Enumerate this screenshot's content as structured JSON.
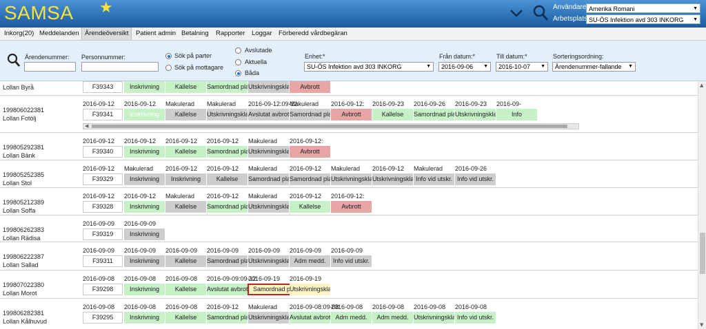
{
  "header": {
    "app_title": "SAMSA",
    "user_label": "Användare:",
    "user_value": "Amerika Romani",
    "workplace_label": "Arbetsplats:",
    "workplace_value": "SU-ÖS Infektion avd 303 INKORG"
  },
  "menu": [
    {
      "label": "Inkorg(20)",
      "active": false
    },
    {
      "label": "Meddelanden",
      "active": false
    },
    {
      "label": "Ärendeöversikt",
      "active": true
    },
    {
      "label": "Patient admin",
      "active": false
    },
    {
      "label": "Betalning",
      "active": false
    },
    {
      "label": "Rapporter",
      "active": false
    },
    {
      "label": "Loggar",
      "active": false
    },
    {
      "label": "Förberedd vårdbegäran",
      "active": false
    }
  ],
  "filters": {
    "case_number_label": "Ärendenummer:",
    "personal_number_label": "Personnummer:",
    "search_parties_label": "Sök på parter",
    "search_receiver_label": "Sök på mottagare",
    "status_completed_label": "Avslutade",
    "status_current_label": "Aktuella",
    "status_both_label": "Båda",
    "unit_label": "Enhet:*",
    "unit_value": "SU-ÖS Infektion avd 303 INKORG",
    "from_date_label": "Från datum:*",
    "from_date_value": "2016-09-06",
    "to_date_label": "Till datum:*",
    "to_date_value": "2016-10-07",
    "sort_label": "Sorteringsordning:",
    "sort_value": "Ärendenummer-fallande"
  },
  "rows": [
    {
      "pnr": "",
      "name": "Lollan Byrå",
      "case": "F39343",
      "steps": [
        {
          "label": "Inskrivning",
          "status": "green",
          "date": ""
        },
        {
          "label": "Kallelse",
          "status": "green",
          "date": ""
        },
        {
          "label": "Samordnad plan",
          "status": "green",
          "date": ""
        },
        {
          "label": "Utskrivningsklar",
          "status": "grey",
          "date": ""
        },
        {
          "label": "Avbrott",
          "status": "red",
          "date": ""
        }
      ]
    },
    {
      "pnr": "199806022381",
      "name": "Lollan Fotölj",
      "case": "F39341",
      "case_date": "2016-09-12",
      "scroll": true,
      "steps": [
        {
          "label": "Inskrivning",
          "status": "faded",
          "date": "2016-09-12"
        },
        {
          "label": "Kallelse",
          "status": "grey",
          "date": "Makulerad"
        },
        {
          "label": "Utskrivningsklar",
          "status": "grey",
          "date": "Makulerad"
        },
        {
          "label": "Avslutat avbrott",
          "status": "grey",
          "date": "2016-09-12:09-12"
        },
        {
          "label": "Samordnad plan",
          "status": "grey",
          "date": "Makulerad"
        },
        {
          "label": "Avbrott",
          "status": "red",
          "date": "2016-09-12:"
        },
        {
          "label": "Kallelse",
          "status": "green",
          "date": "2016-09-23"
        },
        {
          "label": "Samordnad plan",
          "status": "green",
          "date": "2016-09-26"
        },
        {
          "label": "Utskrivningsklar",
          "status": "green",
          "date": "2016-09-23"
        },
        {
          "label": "Info",
          "status": "green",
          "date": "2016-09-"
        }
      ]
    },
    {
      "pnr": "199805292381",
      "name": "Lollan Bänk",
      "case": "F39340",
      "case_date": "2016-09-12",
      "steps": [
        {
          "label": "Inskrivning",
          "status": "green",
          "date": "2016-09-12"
        },
        {
          "label": "Kallelse",
          "status": "green",
          "date": "2016-09-12"
        },
        {
          "label": "Samordnad plan",
          "status": "green",
          "date": "2016-09-12"
        },
        {
          "label": "Utskrivningsklar",
          "status": "grey",
          "date": "Makulerad"
        },
        {
          "label": "Avbrott",
          "status": "red",
          "date": "2016-09-12:"
        }
      ]
    },
    {
      "pnr": "199805252385",
      "name": "Lollan Stol",
      "case": "F39329",
      "case_date": "2016-09-12",
      "steps": [
        {
          "label": "Inskrivning",
          "status": "grey",
          "date": "Makulerad"
        },
        {
          "label": "Inskrivning",
          "status": "grey",
          "date": "2016-09-12"
        },
        {
          "label": "Kallelse",
          "status": "grey",
          "date": "2016-09-12"
        },
        {
          "label": "Samordnad plan",
          "status": "grey",
          "date": "Makulerad"
        },
        {
          "label": "Samordnad plan",
          "status": "grey",
          "date": "2016-09-12"
        },
        {
          "label": "Utskrivningsklar",
          "status": "grey",
          "date": "Makulerad"
        },
        {
          "label": "Utskrivningsklar",
          "status": "grey",
          "date": "2016-09-12"
        },
        {
          "label": "Info vid utskr.",
          "status": "grey",
          "date": "Makulerad"
        },
        {
          "label": "Info vid utskr.",
          "status": "grey",
          "date": "2016-09-26"
        }
      ]
    },
    {
      "pnr": "199805212389",
      "name": "Lollan Soffa",
      "case": "F39328",
      "case_date": "2016-09-12",
      "steps": [
        {
          "label": "Inskrivning",
          "status": "green",
          "date": "2016-09-12"
        },
        {
          "label": "Kallelse",
          "status": "grey",
          "date": "Makulerad"
        },
        {
          "label": "Samordnad plan",
          "status": "green",
          "date": "2016-09-12"
        },
        {
          "label": "Utskrivningsklar",
          "status": "grey",
          "date": "Makulerad"
        },
        {
          "label": "Kallelse",
          "status": "green",
          "date": "2016-09-12"
        },
        {
          "label": "Avbrott",
          "status": "red",
          "date": "2016-09-12:"
        }
      ]
    },
    {
      "pnr": "199806262383",
      "name": "Lollan Rädisa",
      "case": "F39319",
      "case_date": "2016-09-09",
      "steps": [
        {
          "label": "Inskrivning",
          "status": "grey",
          "date": "2016-09-09"
        }
      ]
    },
    {
      "pnr": "199806222387",
      "name": "Lollan Sallad",
      "case": "F39311",
      "case_date": "2016-09-09",
      "steps": [
        {
          "label": "Inskrivning",
          "status": "grey",
          "date": "2016-09-09"
        },
        {
          "label": "Kallelse",
          "status": "grey",
          "date": "2016-09-09"
        },
        {
          "label": "Samordnad plan",
          "status": "grey",
          "date": "2016-09-09"
        },
        {
          "label": "Utskrivningsklar",
          "status": "grey",
          "date": "2016-09-09"
        },
        {
          "label": "Adm medd.",
          "status": "grey",
          "date": "2016-09-09"
        },
        {
          "label": "Info vid utskr.",
          "status": "grey",
          "date": "2016-09-09"
        }
      ]
    },
    {
      "pnr": "199807022380",
      "name": "Lollan Morot",
      "case": "F39298",
      "case_date": "2016-09-08",
      "steps": [
        {
          "label": "Inskrivning",
          "status": "green",
          "date": "2016-09-08"
        },
        {
          "label": "Kallelse",
          "status": "green",
          "date": "2016-09-08"
        },
        {
          "label": "Avslutat avbrott",
          "status": "green",
          "date": "2016-09-09:09-12"
        },
        {
          "label": "Samordnad plan",
          "status": "yellow",
          "date": "2016-09-19",
          "selected": true
        },
        {
          "label": "Utskrivningsklar",
          "status": "yellow",
          "date": "2016-09-19"
        }
      ]
    },
    {
      "pnr": "199806282381",
      "name": "Lollan Kålhuvud",
      "case": "F39295",
      "case_date": "2016-09-08",
      "steps": [
        {
          "label": "Inskrivning",
          "status": "green",
          "date": "2016-09-08"
        },
        {
          "label": "Kallelse",
          "status": "green",
          "date": "2016-09-08"
        },
        {
          "label": "Samordnad plan",
          "status": "green",
          "date": "2016-09-12"
        },
        {
          "label": "Utskrivningsklar",
          "status": "grey",
          "date": "Makulerad"
        },
        {
          "label": "Avslutat avbrott",
          "status": "green",
          "date": "2016-09-08:09-08"
        },
        {
          "label": "Adm medd.",
          "status": "green",
          "date": "2016-09-08"
        },
        {
          "label": "Adm medd.",
          "status": "green",
          "date": "2016-09-08"
        },
        {
          "label": "Utskrivningsklar",
          "status": "green",
          "date": "2016-09-08"
        },
        {
          "label": "Info vid utskr.",
          "status": "green",
          "date": "2016-09-08"
        }
      ]
    }
  ],
  "colors": {
    "header_bg": "#2a6fb8",
    "logo": "#f7e33a",
    "done": "#c6f0c6",
    "cancelled": "#cdcdcd",
    "interrupted": "#e8a5a5",
    "pending": "#fbf3c4",
    "selection": "#c8201f"
  },
  "icons": {
    "logo_star": "star-icon",
    "collapse": "chevron-down-icon",
    "search": "search-icon"
  }
}
